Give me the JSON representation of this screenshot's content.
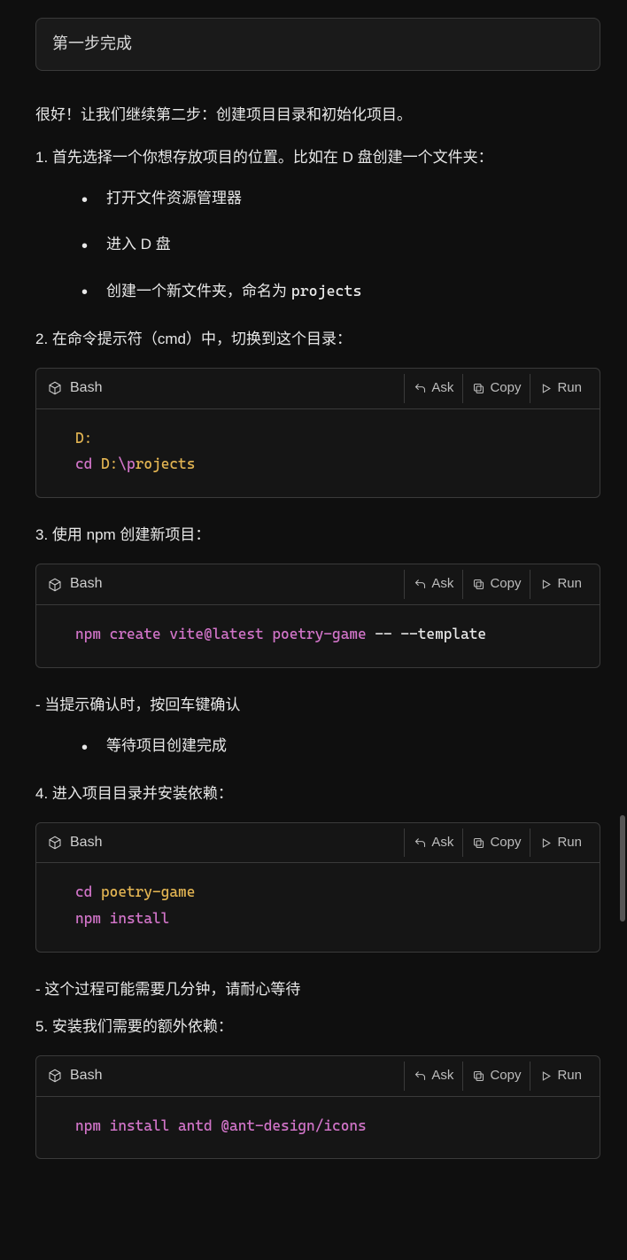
{
  "user_message": "第一步完成",
  "assistant": {
    "intro": "很好！让我们继续第二步：创建项目目录和初始化项目。",
    "step1_text": "1. 首先选择一个你想存放项目的位置。比如在 D 盘创建一个文件夹：",
    "step1_bullets": [
      "打开文件资源管理器",
      "进入 D 盘"
    ],
    "step1_bullet3_prefix": "创建一个新文件夹，命名为 ",
    "step1_bullet3_code": "projects",
    "step2_text": "2. 在命令提示符（cmd）中，切换到这个目录：",
    "step3_text": "3. 使用 npm 创建新项目：",
    "step3_after": "- 当提示确认时，按回车键确认",
    "step3_bullet": "等待项目创建完成",
    "step4_text": "4. 进入项目目录并安装依赖：",
    "step4_after": "- 这个过程可能需要几分钟，请耐心等待",
    "step5_text": "5. 安装我们需要的额外依赖："
  },
  "labels": {
    "lang": "Bash",
    "ask": "Ask",
    "copy": "Copy",
    "run": "Run"
  },
  "code": {
    "b1_l1": "D:",
    "b1_l2a": "cd",
    "b1_l2b": " D:",
    "b1_l2c": "\\p",
    "b1_l2d": "rojects",
    "b2_l1a": "npm create vite@latest poetry-game ",
    "b2_l1b": "-- --template",
    "b3_l1a": "cd",
    "b3_l1b": " poetry-game",
    "b3_l2": "npm install",
    "b4_l1": "npm install antd @ant-design/icons"
  }
}
